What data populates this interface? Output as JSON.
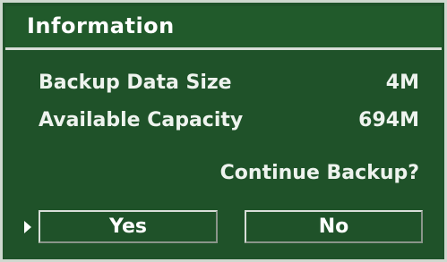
{
  "dialog": {
    "title": "Information",
    "rows": [
      {
        "label": "Backup Data Size",
        "value": "4M"
      },
      {
        "label": "Available Capacity",
        "value": "694M"
      }
    ],
    "question": "Continue Backup?",
    "buttons": {
      "yes": "Yes",
      "no": "No"
    },
    "selected_button": "yes",
    "colors": {
      "background": "#1f5229",
      "border": "#d7ddd7",
      "text": "#ffffff"
    }
  }
}
